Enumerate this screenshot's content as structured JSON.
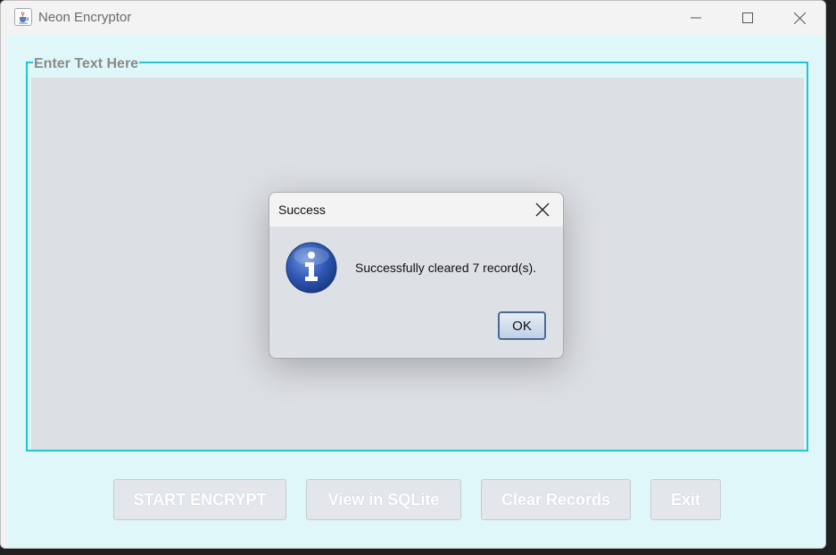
{
  "window": {
    "title": "Neon Encryptor",
    "icon": "java-cup-icon"
  },
  "panel": {
    "legend": "Enter Text Here",
    "text_value": ""
  },
  "buttons": {
    "start_encrypt": "START ENCRYPT",
    "view_sqlite": "View in SQLite",
    "clear_records": "Clear Records",
    "exit": "Exit"
  },
  "dialog": {
    "title": "Success",
    "message": "Successfully cleared 7 record(s).",
    "ok_label": "OK",
    "icon": "information-icon"
  },
  "colors": {
    "content_bg": "#e0f7f9",
    "panel_border": "#22c4d8",
    "info_blue": "#2f57b3"
  }
}
